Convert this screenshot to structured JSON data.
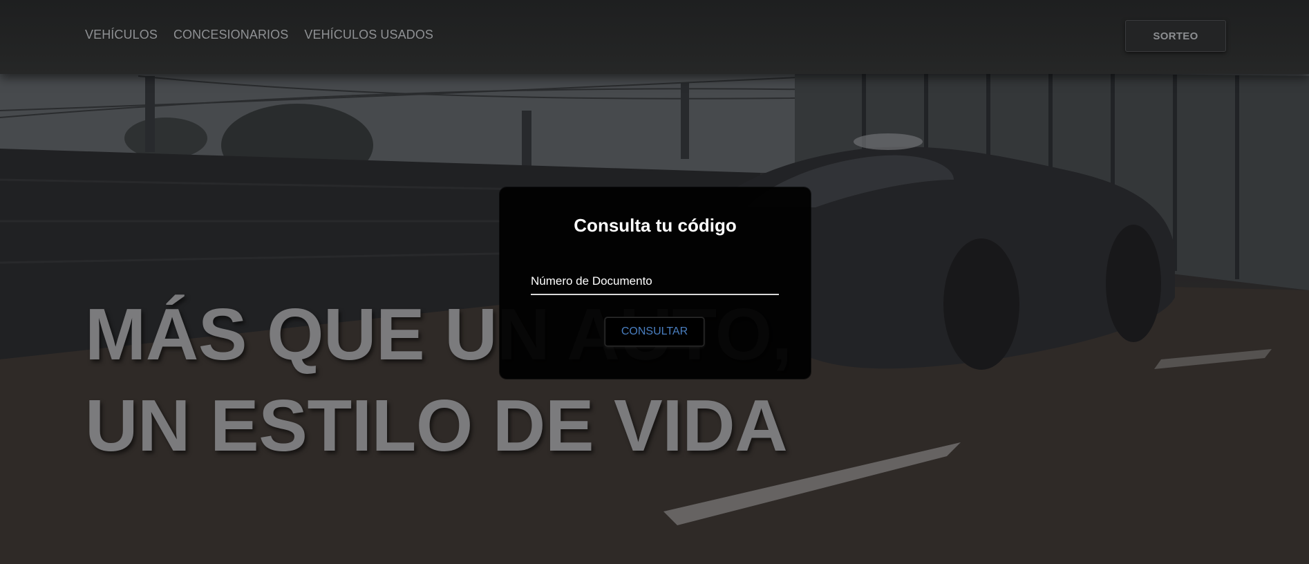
{
  "nav": {
    "items": [
      {
        "label": "VEHÍCULOS"
      },
      {
        "label": "CONCESIONARIOS"
      },
      {
        "label": "VEHÍCULOS USADOS"
      }
    ],
    "cta_label": "SORTEO"
  },
  "hero": {
    "line1": "MÁS QUE UN AUTO,",
    "line2": "UN ESTILO DE VIDA",
    "background_image": "black sports car driving on highway beside glass barrier"
  },
  "modal": {
    "title": "Consulta tu código",
    "document_field": {
      "placeholder": "Número de Documento",
      "value": ""
    },
    "submit_label": "CONSULTAR"
  },
  "colors": {
    "nav_text": "#8f9194",
    "headline": "#7b7b7d",
    "modal_bg": "#000000",
    "button_text": "#4a7fc1"
  }
}
